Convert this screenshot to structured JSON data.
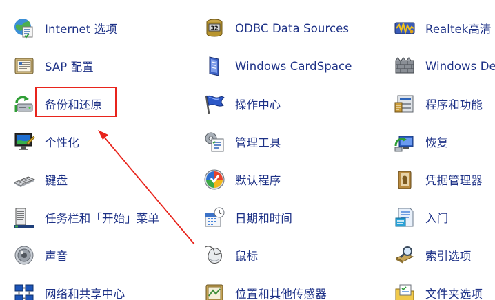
{
  "control_panel": {
    "columns": [
      {
        "items": [
          {
            "label": "Internet 选项",
            "icon": "internet-options-icon"
          },
          {
            "label": "SAP 配置",
            "icon": "sap-config-icon"
          },
          {
            "label": "备份和还原",
            "icon": "backup-restore-icon"
          },
          {
            "label": "个性化",
            "icon": "personalization-icon"
          },
          {
            "label": "键盘",
            "icon": "keyboard-icon"
          },
          {
            "label": "任务栏和「开始」菜单",
            "icon": "taskbar-start-menu-icon"
          },
          {
            "label": "声音",
            "icon": "sound-icon"
          },
          {
            "label": "网络和共享中心",
            "icon": "network-sharing-icon"
          }
        ]
      },
      {
        "items": [
          {
            "label": "ODBC Data Sources",
            "icon": "odbc-data-sources-icon"
          },
          {
            "label": "Windows CardSpace",
            "icon": "windows-cardspace-icon"
          },
          {
            "label": "操作中心",
            "icon": "action-center-flag-icon"
          },
          {
            "label": "管理工具",
            "icon": "admin-tools-icon"
          },
          {
            "label": "默认程序",
            "icon": "default-programs-icon"
          },
          {
            "label": "日期和时间",
            "icon": "date-time-icon"
          },
          {
            "label": "鼠标",
            "icon": "mouse-icon"
          },
          {
            "label": "位置和其他传感器",
            "icon": "location-sensors-icon"
          }
        ]
      },
      {
        "items": [
          {
            "label": "Realtek高清",
            "icon": "realtek-audio-icon"
          },
          {
            "label": "Windows De",
            "icon": "windows-defender-icon"
          },
          {
            "label": "程序和功能",
            "icon": "programs-features-icon"
          },
          {
            "label": "恢复",
            "icon": "recovery-icon"
          },
          {
            "label": "凭据管理器",
            "icon": "credential-manager-icon"
          },
          {
            "label": "入门",
            "icon": "getting-started-icon"
          },
          {
            "label": "索引选项",
            "icon": "indexing-options-icon"
          },
          {
            "label": "文件夹选项",
            "icon": "folder-options-icon"
          }
        ]
      }
    ]
  },
  "annotation": {
    "highlighted_item": "备份和还原",
    "box_color": "#e8241c",
    "arrow_color": "#e8241c"
  },
  "colors": {
    "link_text": "#1e3287",
    "background": "#ffffff"
  }
}
